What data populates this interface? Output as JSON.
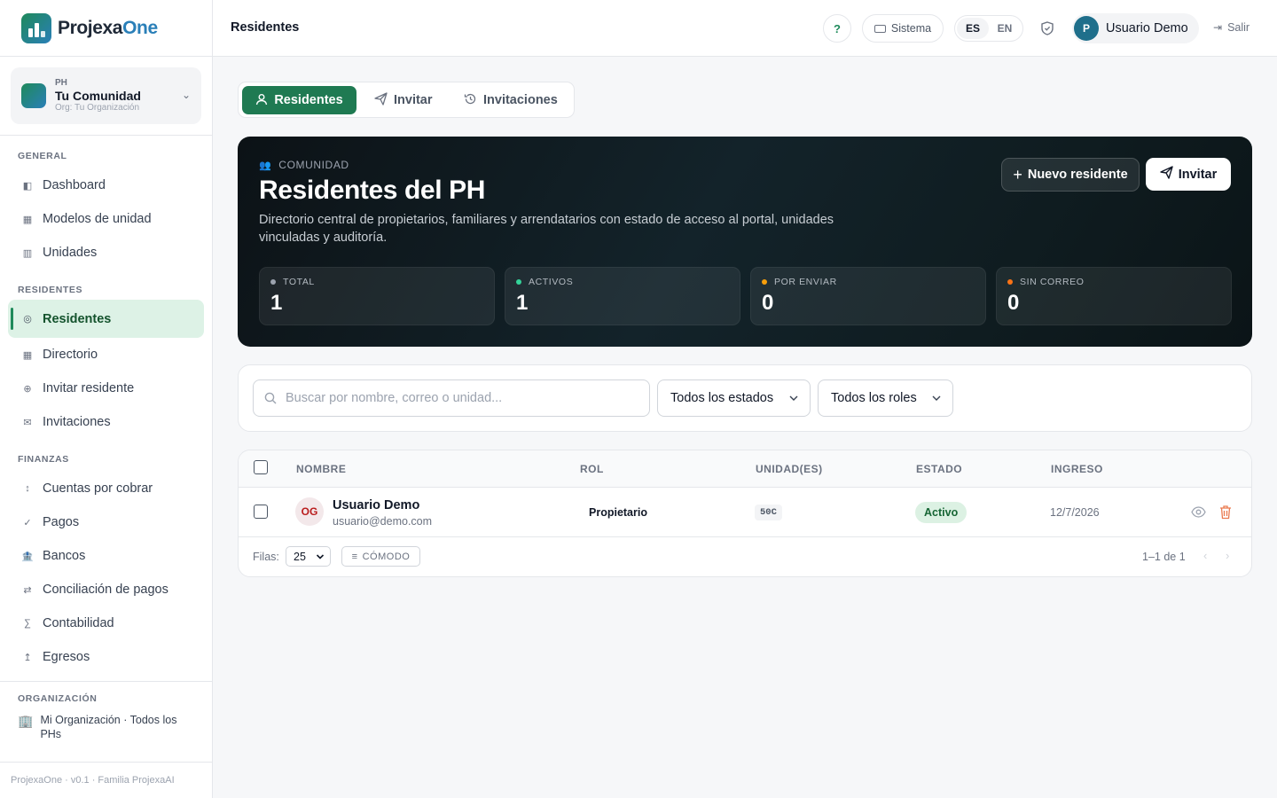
{
  "brand": {
    "name_part1": "Projexa",
    "name_part2": "One"
  },
  "community": {
    "kicker": "PH",
    "name": "Tu Comunidad",
    "org": "Org: Tu Organización"
  },
  "sidebar": {
    "sections": [
      {
        "label": "GENERAL",
        "items": [
          {
            "label": "Dashboard",
            "icon": "◧"
          },
          {
            "label": "Modelos de unidad",
            "icon": "▦"
          },
          {
            "label": "Unidades",
            "icon": "▥"
          }
        ]
      },
      {
        "label": "RESIDENTES",
        "items": [
          {
            "label": "Residentes",
            "icon": "◎"
          },
          {
            "label": "Directorio",
            "icon": "▦"
          },
          {
            "label": "Invitar residente",
            "icon": "⊕"
          },
          {
            "label": "Invitaciones",
            "icon": "✉"
          }
        ]
      },
      {
        "label": "FINANZAS",
        "items": [
          {
            "label": "Cuentas por cobrar",
            "icon": "↕"
          },
          {
            "label": "Pagos",
            "icon": "✓"
          },
          {
            "label": "Bancos",
            "icon": "🏦"
          },
          {
            "label": "Conciliación de pagos",
            "icon": "⇄"
          },
          {
            "label": "Contabilidad",
            "icon": "∑"
          },
          {
            "label": "Egresos",
            "icon": "↥"
          }
        ]
      }
    ],
    "org_section": {
      "label": "ORGANIZACIÓN",
      "entry": "Mi Organización · Todos los PHs",
      "icon": "🏢"
    },
    "footer": "ProjexaOne · v0.1 · Familia ProjexaAI"
  },
  "topbar": {
    "title": "Residentes",
    "help": "?",
    "theme": "Sistema",
    "lang_es": "ES",
    "lang_en": "EN",
    "user_initial": "P",
    "user_name": "Usuario Demo",
    "logout": "Salir"
  },
  "tabs": [
    {
      "label": "Residentes",
      "active": true
    },
    {
      "label": "Invitar",
      "active": false
    },
    {
      "label": "Invitaciones",
      "active": false
    }
  ],
  "hero": {
    "kicker": "COMUNIDAD",
    "title": "Residentes del PH",
    "description": "Directorio central de propietarios, familiares y arrendatarios con estado de acceso al portal, unidades vinculadas y auditoría.",
    "new_button": "Nuevo residente",
    "invite_button": "Invitar",
    "stats": [
      {
        "label": "TOTAL",
        "value": "1",
        "dot_color": "#9ca3af"
      },
      {
        "label": "ACTIVOS",
        "value": "1",
        "dot_color": "#34d399"
      },
      {
        "label": "POR ENVIAR",
        "value": "0",
        "dot_color": "#f59e0b"
      },
      {
        "label": "SIN CORREO",
        "value": "0",
        "dot_color": "#f97316"
      }
    ]
  },
  "filters": {
    "search_placeholder": "Buscar por nombre, correo o unidad...",
    "status_select": "Todos los estados",
    "role_select": "Todos los roles"
  },
  "table": {
    "columns": [
      "NOMBRE",
      "ROL",
      "UNIDAD(ES)",
      "ESTADO",
      "INGRESO"
    ],
    "rows": [
      {
        "initials": "OG",
        "name": "Usuario Demo",
        "email": "usuario@demo.com",
        "role": "Propietario",
        "unit": "50C",
        "status": "Activo",
        "date": "12/7/2026"
      }
    ],
    "footer": {
      "rows_label": "Filas:",
      "rows_value": "25",
      "density": "CÓMODO",
      "range": "1–1 de 1"
    }
  },
  "colors": {
    "accent": "#1f7a52",
    "brand_blue": "#2a7fb8",
    "hero_bg": "#0f1c20",
    "status_active_bg": "#dcf1e3"
  }
}
